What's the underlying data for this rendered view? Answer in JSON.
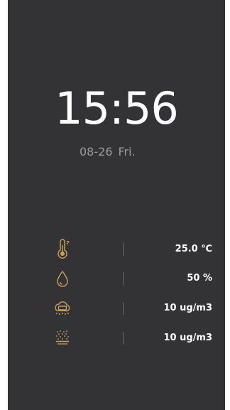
{
  "clock": {
    "time": "15:56",
    "date": "08-26",
    "weekday": "Fri."
  },
  "sensors": [
    {
      "name": "temperature",
      "icon": "thermometer-icon",
      "value": "25.0 ℃"
    },
    {
      "name": "humidity",
      "icon": "water-drop-icon",
      "value": "50 %"
    },
    {
      "name": "pm25",
      "icon": "pm25-icon",
      "value": "10 ug/m3"
    },
    {
      "name": "pm10",
      "icon": "pm10-icon",
      "value": "10 ug/m3"
    }
  ],
  "colors": {
    "background": "#333235",
    "accent_gold": "#c9a15a",
    "date_gray": "#9b9b9f",
    "text": "#ffffff"
  }
}
